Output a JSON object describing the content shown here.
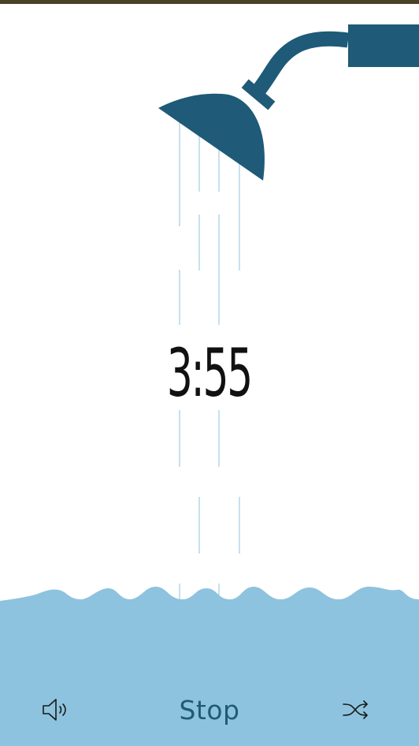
{
  "timer": {
    "display": "3:55"
  },
  "controls": {
    "sound_icon": "speaker-volume-icon",
    "stop_label": "Stop",
    "shuffle_icon": "shuffle-icon"
  },
  "colors": {
    "top_bar": "#4a4227",
    "shower": "#1f5a78",
    "water_stream": "#8ec3de",
    "water": "#8dc3de",
    "text_dark": "#111111",
    "button_text": "#1f5a78"
  }
}
